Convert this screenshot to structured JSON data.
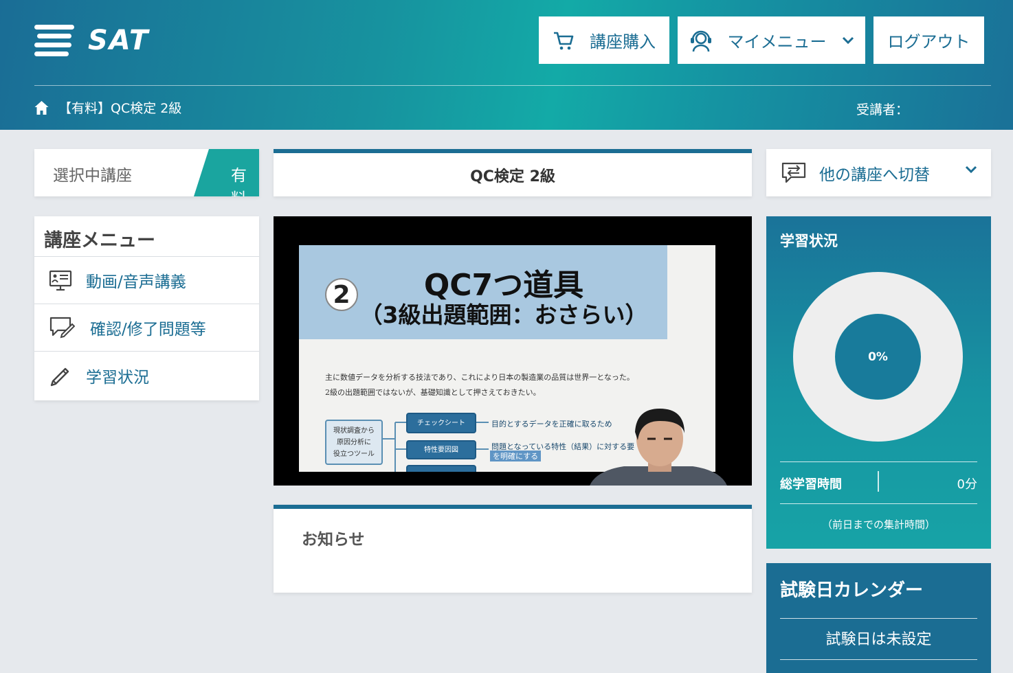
{
  "header": {
    "logo_text": "SAT",
    "buttons": {
      "purchase": "講座購入",
      "mymenu": "マイメニュー",
      "logout": "ログアウト"
    },
    "breadcrumb": "【有料】QC検定 2級",
    "student_label": "受講者："
  },
  "selected_course": {
    "label": "選択中講座",
    "badge": "有料"
  },
  "course_menu": {
    "title": "講座メニュー",
    "items": [
      {
        "label": "動画/音声講義",
        "icon": "monitor-lecture-icon"
      },
      {
        "label": "確認/修了問題等",
        "icon": "checklist-chat-icon"
      },
      {
        "label": "学習状況",
        "icon": "pencil-icon"
      }
    ]
  },
  "course_title": "QC検定 2級",
  "video": {
    "slide_number": "2",
    "slide_title": "QC7つ道具",
    "slide_subtitle": "（3級出題範囲：おさらい）",
    "slide_body_line1": "主に数値データを分析する技法であり、これにより日本の製造業の品質は世界一となった。",
    "slide_body_line2": "2級の出題範囲ではないが、基礎知識として押さえておきたい。",
    "node_left": "現状調査から\n原因分析に\n役立つツール",
    "node_check": "チェックシート",
    "node_fishbone": "特性要因図",
    "desc1": "目的とするデータを正確に取るため",
    "desc2": "問題となっている特性（結果）に対する要",
    "desc3": "を明確にする"
  },
  "news": {
    "title": "お知らせ"
  },
  "switch_course": {
    "label": "他の講座へ切替"
  },
  "study_status": {
    "title": "学習状況",
    "progress_percent": 0,
    "progress_label": "0%",
    "total_time_label": "総学習時間",
    "total_time_value": "0分",
    "note": "（前日までの集計時間）"
  },
  "exam_calendar": {
    "title": "試験日カレンダー",
    "value": "試験日は未設定"
  },
  "colors": {
    "primary": "#1b6d93",
    "accent": "#1aa59f",
    "donut_ring": "#eeeeee"
  }
}
